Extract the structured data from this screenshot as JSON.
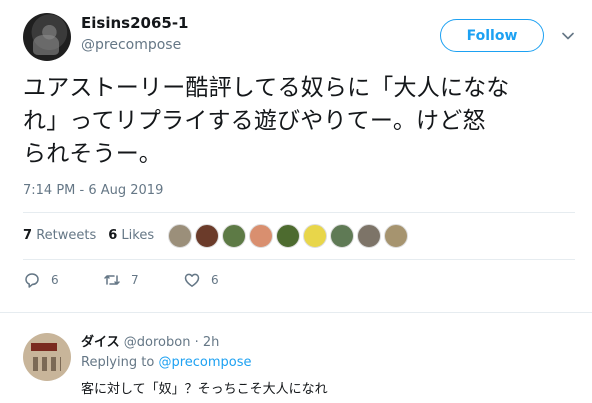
{
  "tweet": {
    "author": {
      "display_name": "Eisins2065-1",
      "handle": "@precompose"
    },
    "follow_label": "Follow",
    "text_lines": [
      "ユアストーリー酷評してる奴らに「大人になな",
      "れ」ってリプライする遊びやりてー。けど怒",
      "られそうー。"
    ],
    "timestamp": "7:14 PM - 6 Aug 2019",
    "stats": {
      "retweets_count": "7",
      "retweets_label": "Retweets",
      "likes_count": "6",
      "likes_label": "Likes"
    },
    "likers": [
      {
        "color": "#9b8f7a"
      },
      {
        "color": "#6b3b2a"
      },
      {
        "color": "#5d7a45"
      },
      {
        "color": "#d98f6f"
      },
      {
        "color": "#4d6b2f"
      },
      {
        "color": "#e8d64a"
      },
      {
        "color": "#5f7a55"
      },
      {
        "color": "#7d7468"
      },
      {
        "color": "#a6946f"
      }
    ],
    "actions": {
      "replies": "6",
      "retweets": "7",
      "likes": "6"
    }
  },
  "reply": {
    "display_name": "ダイス",
    "handle": "@dorobon",
    "separator": "·",
    "time": "2h",
    "replying_prefix": "Replying to",
    "replying_to": "@precompose",
    "text": "客に対して「奴」？そっちこそ大人になれ"
  },
  "colors": {
    "accent": "#1da1f2",
    "muted": "#657786",
    "text": "#14171a",
    "divider": "#e6ecf0"
  }
}
